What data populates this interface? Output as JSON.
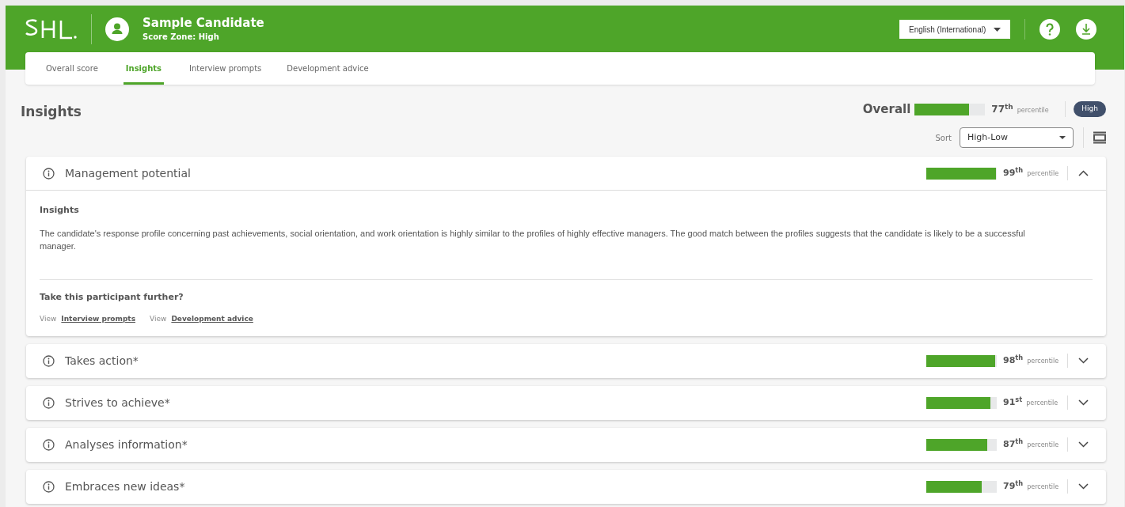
{
  "header": {
    "candidate_name": "Sample Candidate",
    "score_zone": "Score Zone: High",
    "language": "English (International)"
  },
  "tabs": [
    {
      "label": "Overall score",
      "selected": false
    },
    {
      "label": "Insights",
      "selected": true
    },
    {
      "label": "Interview prompts",
      "selected": false
    },
    {
      "label": "Development advice",
      "selected": false
    }
  ],
  "page_title": "Insights",
  "overall": {
    "label": "Overall",
    "level": 0.77,
    "score": "77$^{th}$",
    "unit": "percentile",
    "badge": "High"
  },
  "sort": {
    "label": "Sort",
    "value": "High-Low"
  },
  "competencies": [
    {
      "title": "Management potential",
      "level": 0.99,
      "score": "99$^{th}$",
      "unit": "percentile",
      "expanded": true,
      "insights_heading": "Insights",
      "insights_text": "The candidate's response profile concerning past achievements, social orientation, and work orientation is highly similar to the profiles of highly effective managers. The good match between the profiles suggests that the candidate is likely to be a successful manager.",
      "further_heading": "Take this participant further?",
      "links": [
        {
          "prefix": "View",
          "label": "Interview prompts"
        },
        {
          "prefix": "View",
          "label": "Development advice"
        }
      ]
    },
    {
      "title": "Takes action*",
      "level": 0.98,
      "score": "98$^{th}$",
      "unit": "percentile",
      "expanded": false
    },
    {
      "title": "Strives to achieve*",
      "level": 0.91,
      "score": "91$^{st}$",
      "unit": "percentile",
      "expanded": false
    },
    {
      "title": "Analyses information*",
      "level": 0.87,
      "score": "87$^{th}$",
      "unit": "percentile",
      "expanded": false
    },
    {
      "title": "Embraces new ideas*",
      "level": 0.79,
      "score": "79$^{th}$",
      "unit": "percentile",
      "expanded": false
    }
  ]
}
